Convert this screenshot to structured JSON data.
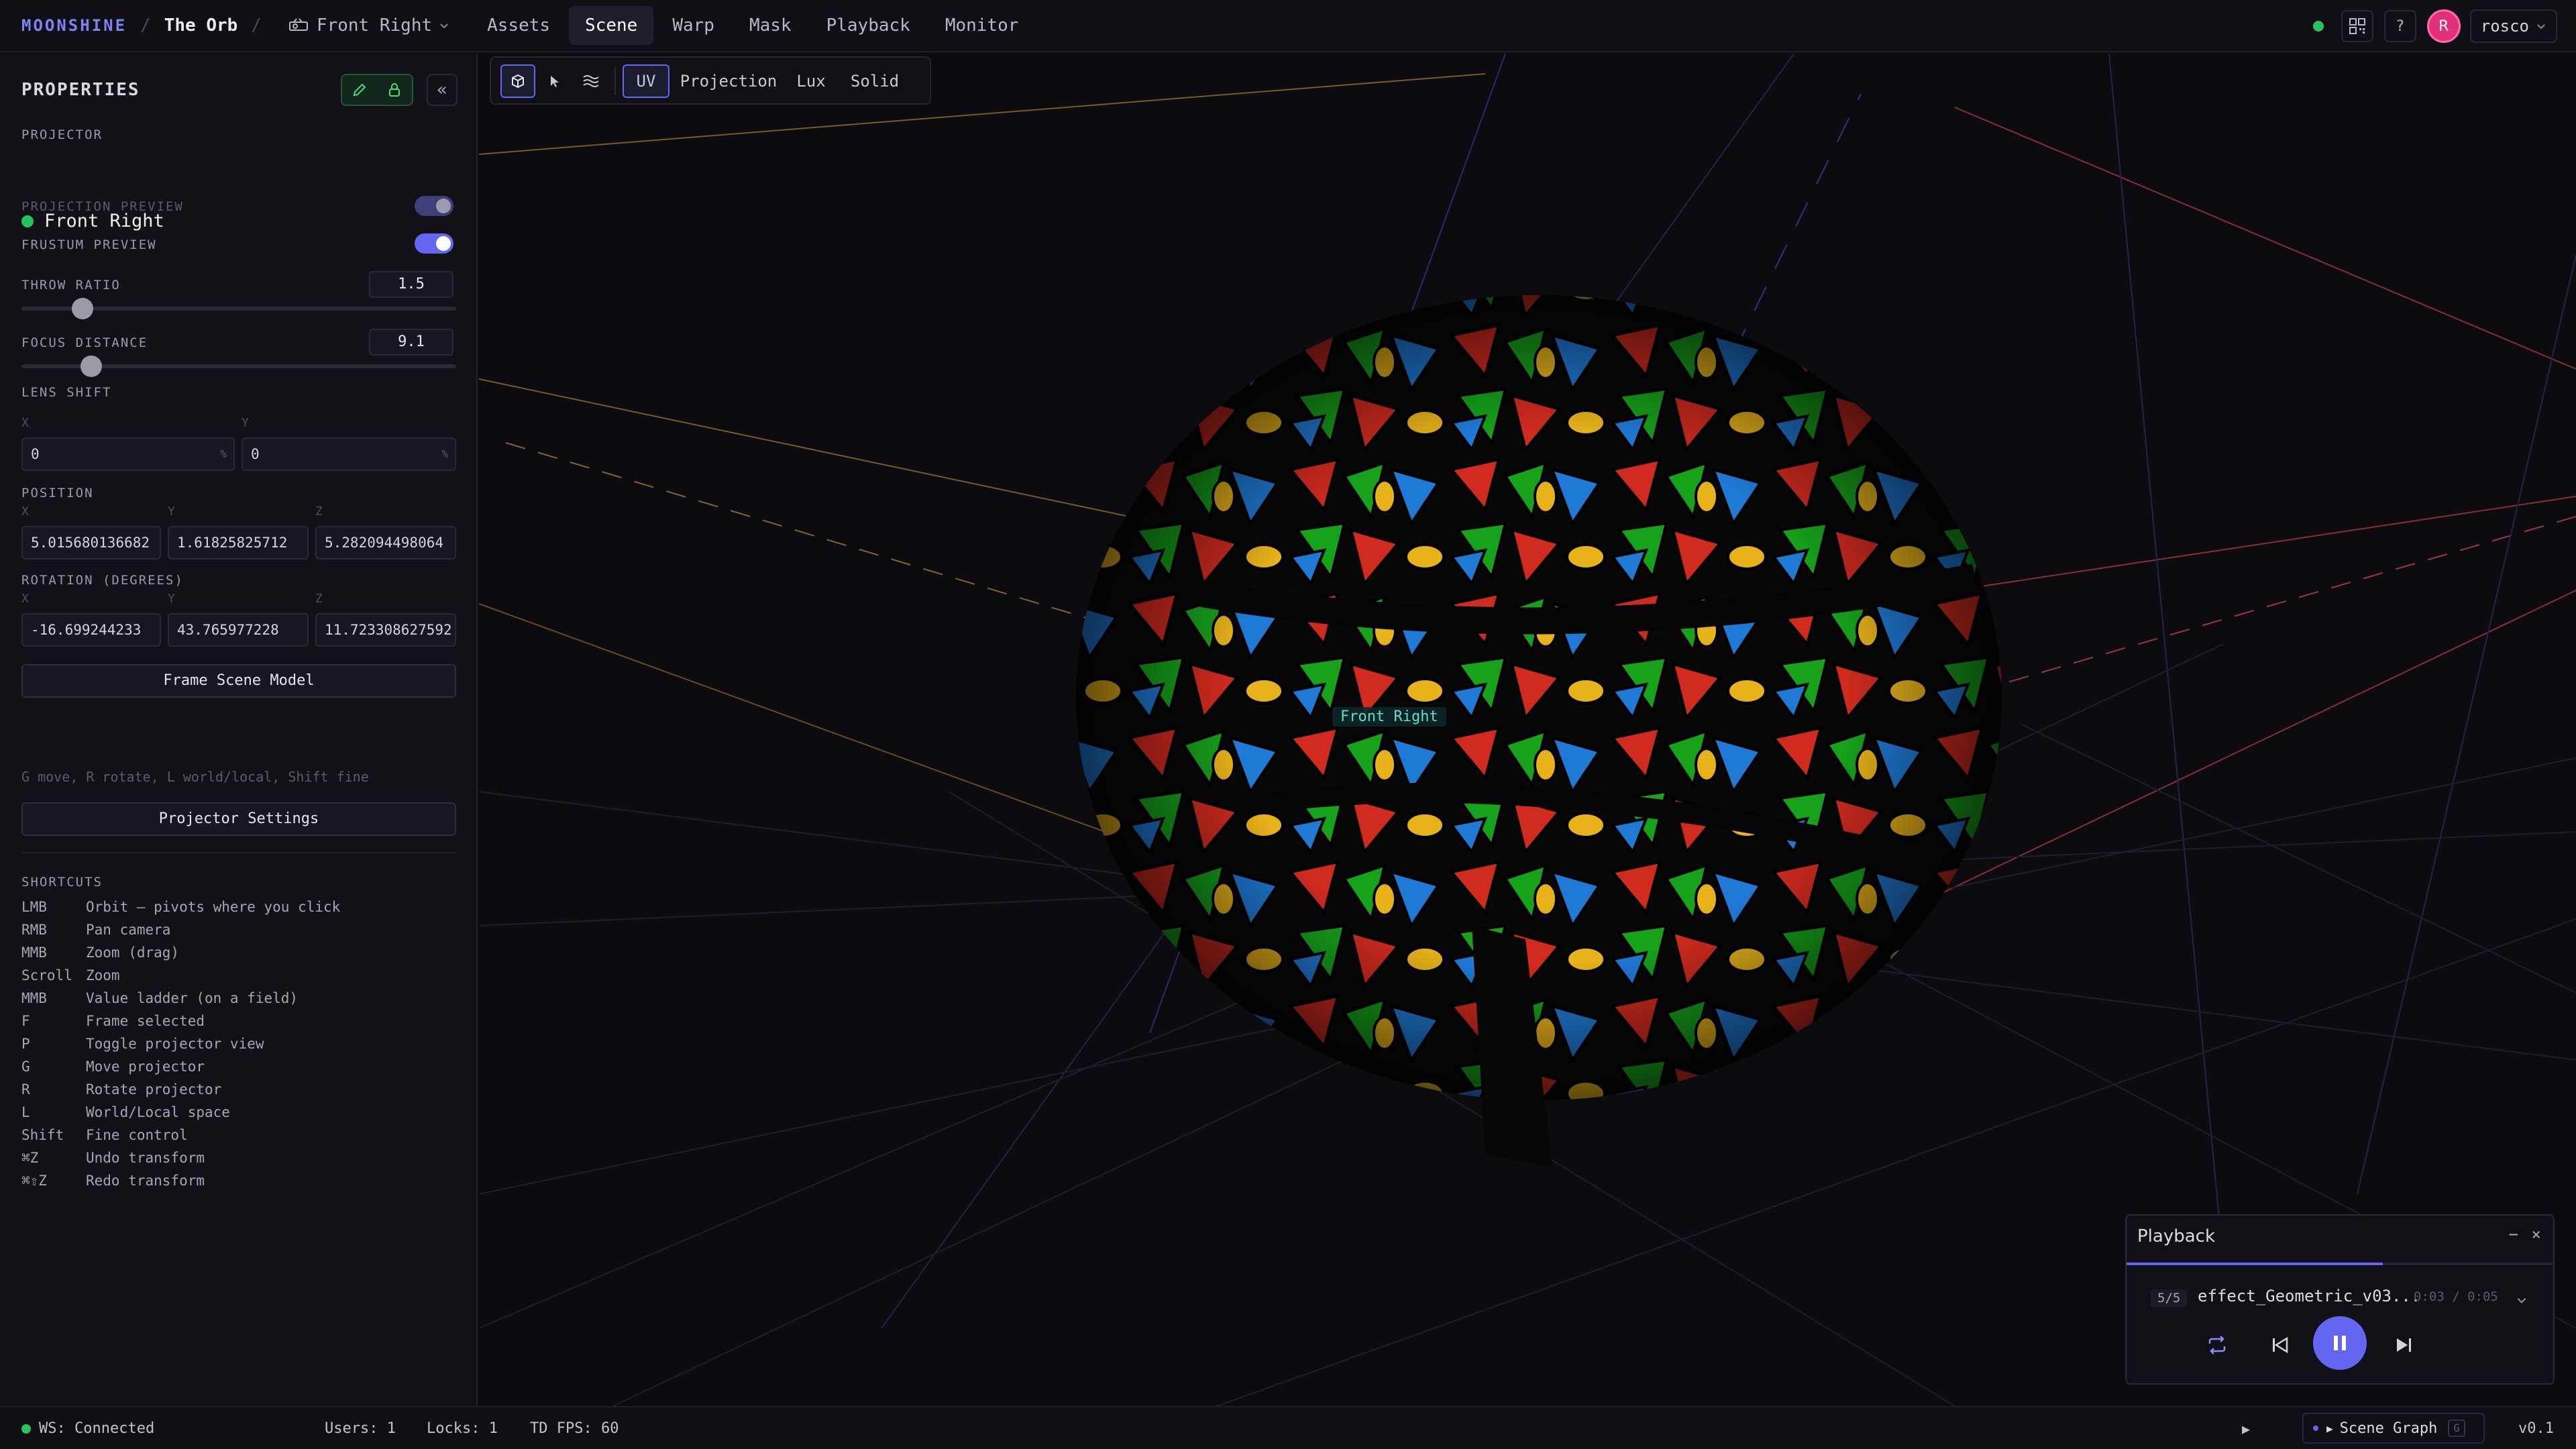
{
  "header": {
    "brand": "MOONSHINE",
    "separator": "/",
    "project": "The Orb",
    "projector_select": "Front Right",
    "tabs": [
      {
        "label": "Assets"
      },
      {
        "label": "Scene"
      },
      {
        "label": "Warp"
      },
      {
        "label": "Mask"
      },
      {
        "label": "Playback"
      },
      {
        "label": "Monitor"
      }
    ],
    "active_tab": "Scene",
    "help_label": "?",
    "avatar_initial": "R",
    "user": "rosco"
  },
  "properties": {
    "title": "PROPERTIES",
    "collapse_label": "«",
    "projector_label": "PROJECTOR",
    "projector_name": "Front Right",
    "projection_preview_label": "PROJECTION PREVIEW",
    "projection_preview_on": true,
    "frustum_preview_label": "FRUSTUM PREVIEW",
    "frustum_preview_on": true,
    "throw_ratio_label": "THROW RATIO",
    "throw_ratio": "1.5",
    "throw_ratio_slider": 0.14,
    "focus_distance_label": "FOCUS DISTANCE",
    "focus_distance": "9.1",
    "focus_distance_slider": 0.16,
    "lens_shift_label": "LENS SHIFT",
    "lens_shift": {
      "x_label": "X",
      "y_label": "Y",
      "x": "0",
      "y": "0",
      "unit": "%"
    },
    "position_label": "POSITION",
    "position": {
      "x_label": "X",
      "y_label": "Y",
      "z_label": "Z",
      "x": "5.015680136682",
      "y": "1.61825825712",
      "z": "5.282094498064"
    },
    "rotation_label": "ROTATION (DEGREES)",
    "rotation": {
      "x_label": "X",
      "y_label": "Y",
      "z_label": "Z",
      "x": "-16.699244233",
      "y": "43.765977228",
      "z": "11.723308627592"
    },
    "frame_button": "Frame Scene Model",
    "hint": "G move, R rotate, L world/local, Shift fine",
    "settings_button": "Projector Settings",
    "shortcuts_label": "SHORTCUTS",
    "shortcuts": [
      {
        "key": "LMB",
        "desc": "Orbit — pivots where you click"
      },
      {
        "key": "RMB",
        "desc": "Pan camera"
      },
      {
        "key": "MMB",
        "desc": "Zoom (drag)"
      },
      {
        "key": "Scroll",
        "desc": "Zoom"
      },
      {
        "key": "MMB",
        "desc": "Value ladder (on a field)"
      },
      {
        "key": "F",
        "desc": "Frame selected"
      },
      {
        "key": "P",
        "desc": "Toggle projector view"
      },
      {
        "key": "G",
        "desc": "Move projector"
      },
      {
        "key": "R",
        "desc": "Rotate projector"
      },
      {
        "key": "L",
        "desc": "World/Local space"
      },
      {
        "key": "Shift",
        "desc": "Fine control"
      },
      {
        "key": "⌘Z",
        "desc": "Undo transform"
      },
      {
        "key": "⌘⇧Z",
        "desc": "Redo transform"
      }
    ]
  },
  "viewport": {
    "modes": {
      "uv": "UV",
      "projection": "Projection",
      "lux": "Lux",
      "solid": "Solid"
    },
    "active_mode": "UV",
    "projector_label": "Front Right"
  },
  "playback": {
    "title": "Playback",
    "minimize": "−",
    "close": "×",
    "progress": 0.6,
    "count": "5/5",
    "clip": "effect_Geometric_v03...",
    "time": "0:03 / 0:05"
  },
  "status": {
    "ws": "WS: Connected",
    "users": "Users: 1",
    "locks": "Locks: 1",
    "fps": "TD FPS: 60",
    "scene_graph": "Scene Graph",
    "scene_graph_key": "G",
    "version": "v0.1"
  },
  "colors": {
    "accent": "#6366f1",
    "brand": "#7c83f5",
    "connected": "#22c55e",
    "avatar": "#e0307a"
  }
}
